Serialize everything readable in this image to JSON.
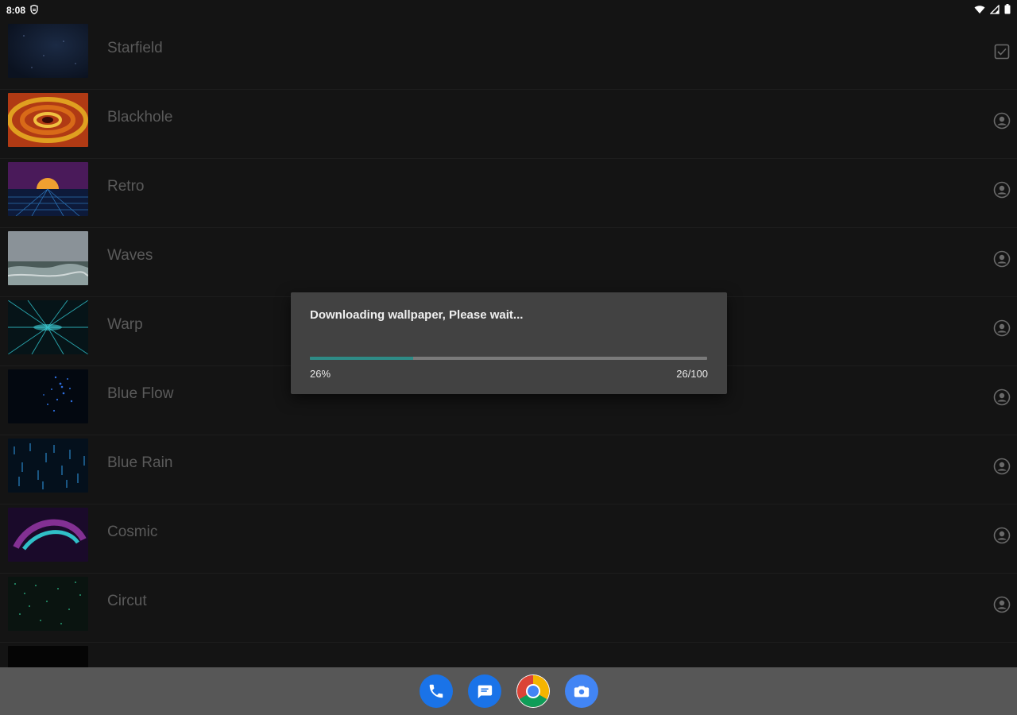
{
  "status_bar": {
    "time": "8:08",
    "icons": [
      "shield-icon",
      "wifi-icon",
      "signal-icon",
      "battery-icon"
    ]
  },
  "wallpapers": [
    {
      "name": "Starfield",
      "action_icon": "checkbox-checked-icon"
    },
    {
      "name": "Blackhole",
      "action_icon": "user-circle-icon"
    },
    {
      "name": "Retro",
      "action_icon": "user-circle-icon"
    },
    {
      "name": "Waves",
      "action_icon": "user-circle-icon"
    },
    {
      "name": "Warp",
      "action_icon": "user-circle-icon"
    },
    {
      "name": "Blue Flow",
      "action_icon": "user-circle-icon"
    },
    {
      "name": "Blue Rain",
      "action_icon": "user-circle-icon"
    },
    {
      "name": "Cosmic",
      "action_icon": "user-circle-icon"
    },
    {
      "name": "Circut",
      "action_icon": "user-circle-icon"
    }
  ],
  "dialog": {
    "message": "Downloading wallpaper, Please wait...",
    "progress_percent_label": "26%",
    "progress_count_label": "26/100",
    "progress_fraction": 0.26,
    "accent_color": "#2e8b86"
  },
  "dock": {
    "apps": [
      "phone-icon",
      "messages-icon",
      "chrome-icon",
      "camera-icon"
    ]
  },
  "colors": {
    "background": "#141414",
    "dialog_bg": "#424242",
    "dock_bg": "#575757",
    "app_blue": "#1a73e8"
  }
}
